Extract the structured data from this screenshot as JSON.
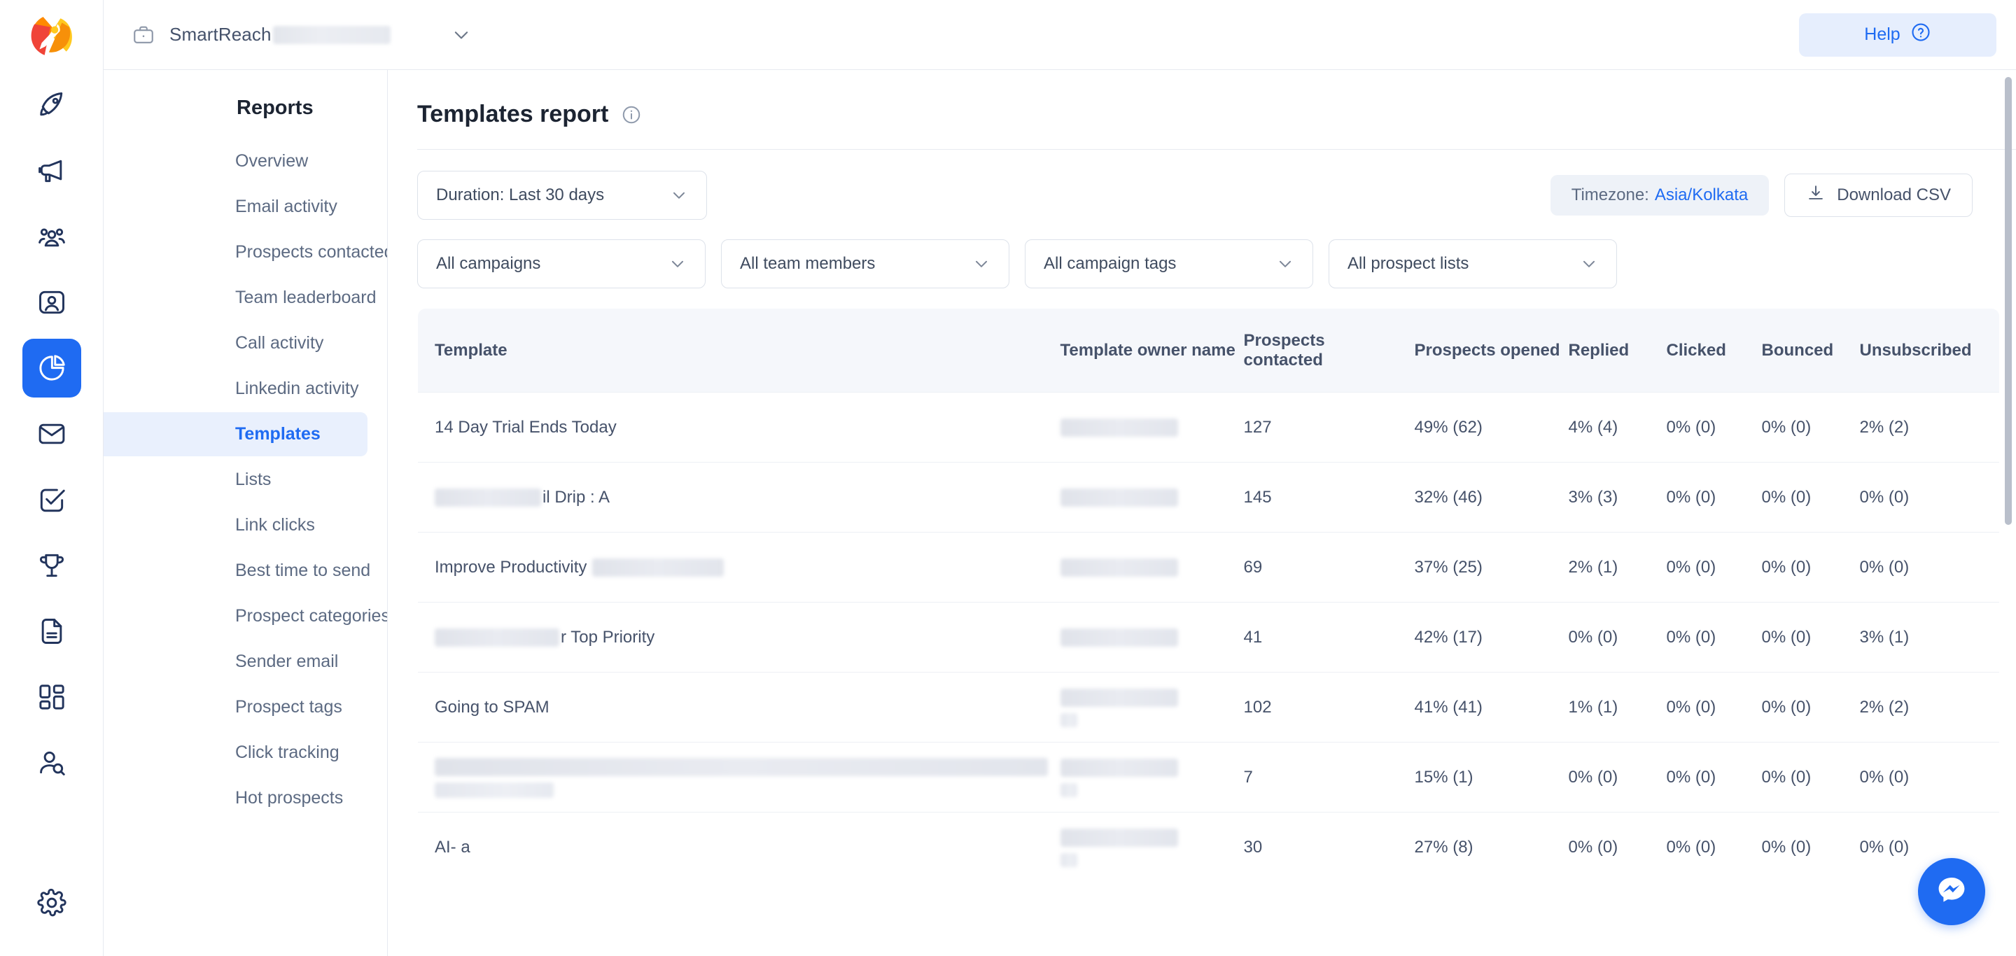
{
  "brand": {
    "name": "SmartReach",
    "logo_icon": "rocket-logo",
    "accent_color": "#1f6bf2"
  },
  "topbar": {
    "workspace_icon": "briefcase-icon",
    "workspace_name": "SmartReach",
    "workspace_name_redacted": true,
    "caret_icon": "chevron-down-icon",
    "help_label": "Help",
    "help_icon": "question-circle-icon"
  },
  "rail": {
    "items": [
      {
        "icon": "rocket-icon",
        "name": "campaigns",
        "active": false
      },
      {
        "icon": "megaphone-icon",
        "name": "outreach",
        "active": false
      },
      {
        "icon": "people-group-icon",
        "name": "prospects",
        "active": false
      },
      {
        "icon": "contact-card-icon",
        "name": "contacts",
        "active": false
      },
      {
        "icon": "pie-chart-icon",
        "name": "reports",
        "active": true
      },
      {
        "icon": "envelope-icon",
        "name": "inbox",
        "active": false
      },
      {
        "icon": "task-check-icon",
        "name": "tasks",
        "active": false
      },
      {
        "icon": "trophy-icon",
        "name": "leaderboard",
        "active": false
      },
      {
        "icon": "document-icon",
        "name": "templates",
        "active": false
      },
      {
        "icon": "grid-apps-icon",
        "name": "apps",
        "active": false
      },
      {
        "icon": "user-search-icon",
        "name": "prospect-finder",
        "active": false
      }
    ],
    "bottom": {
      "icon": "gear-icon",
      "name": "settings"
    }
  },
  "sidebar": {
    "title": "Reports",
    "items": [
      {
        "label": "Overview",
        "active": false
      },
      {
        "label": "Email activity",
        "active": false
      },
      {
        "label": "Prospects contacted",
        "active": false
      },
      {
        "label": "Team leaderboard",
        "active": false
      },
      {
        "label": "Call activity",
        "active": false
      },
      {
        "label": "Linkedin activity",
        "active": false
      },
      {
        "label": "Templates",
        "active": true
      },
      {
        "label": "Lists",
        "active": false
      },
      {
        "label": "Link clicks",
        "active": false
      },
      {
        "label": "Best time to send",
        "active": false
      },
      {
        "label": "Prospect categories",
        "active": false
      },
      {
        "label": "Sender email",
        "active": false
      },
      {
        "label": "Prospect tags",
        "active": false
      },
      {
        "label": "Click tracking",
        "active": false
      },
      {
        "label": "Hot prospects",
        "active": false
      }
    ]
  },
  "main": {
    "title": "Templates report",
    "info_icon": "info-icon",
    "toolbar": {
      "duration_label": "Duration: Last 30 days",
      "timezone_prefix": "Timezone:",
      "timezone_value": "Asia/Kolkata",
      "download_label": "Download CSV",
      "download_icon": "download-icon"
    },
    "filters": [
      {
        "label": "All campaigns",
        "name": "campaigns-filter"
      },
      {
        "label": "All team members",
        "name": "team-members-filter"
      },
      {
        "label": "All campaign tags",
        "name": "campaign-tags-filter"
      },
      {
        "label": "All prospect lists",
        "name": "prospect-lists-filter"
      }
    ],
    "table": {
      "columns": [
        "Template",
        "Template owner name",
        "Prospects contacted",
        "Prospects opened",
        "Replied",
        "Clicked",
        "Bounced",
        "Unsubscribed"
      ],
      "rows": [
        {
          "template": "14 Day Trial Ends Today",
          "template_prefix_redacted": false,
          "template_suffix_redacted": false,
          "owner_redacted": true,
          "owner_two_line": false,
          "contacted": "127",
          "opened": "49% (62)",
          "replied": "4% (4)",
          "clicked": "0% (0)",
          "bounced": "0% (0)",
          "unsubscribed": "2% (2)"
        },
        {
          "template": "il Drip : A",
          "template_prefix_redacted": true,
          "template_suffix_redacted": false,
          "owner_redacted": true,
          "owner_two_line": false,
          "contacted": "145",
          "opened": "32% (46)",
          "replied": "3% (3)",
          "clicked": "0% (0)",
          "bounced": "0% (0)",
          "unsubscribed": "0% (0)"
        },
        {
          "template": "Improve Productivity",
          "template_prefix_redacted": false,
          "template_suffix_redacted": true,
          "owner_redacted": true,
          "owner_two_line": false,
          "contacted": "69",
          "opened": "37% (25)",
          "replied": "2% (1)",
          "clicked": "0% (0)",
          "bounced": "0% (0)",
          "unsubscribed": "0% (0)"
        },
        {
          "template": "r Top Priority",
          "template_prefix_redacted": true,
          "template_suffix_redacted": false,
          "owner_redacted": true,
          "owner_two_line": false,
          "contacted": "41",
          "opened": "42% (17)",
          "replied": "0% (0)",
          "clicked": "0% (0)",
          "bounced": "0% (0)",
          "unsubscribed": "3% (1)"
        },
        {
          "template": "Going to SPAM",
          "template_prefix_redacted": false,
          "template_suffix_redacted": false,
          "owner_redacted": true,
          "owner_two_line": true,
          "contacted": "102",
          "opened": "41% (41)",
          "replied": "1% (1)",
          "clicked": "0% (0)",
          "bounced": "0% (0)",
          "unsubscribed": "2% (2)"
        },
        {
          "template": "",
          "template_prefix_redacted": false,
          "template_suffix_redacted": false,
          "template_fully_redacted": true,
          "owner_redacted": true,
          "owner_two_line": true,
          "contacted": "7",
          "opened": "15% (1)",
          "replied": "0% (0)",
          "clicked": "0% (0)",
          "bounced": "0% (0)",
          "unsubscribed": "0% (0)"
        },
        {
          "template": "AI- a",
          "template_prefix_redacted": false,
          "template_suffix_redacted": false,
          "owner_redacted": true,
          "owner_two_line": true,
          "contacted": "30",
          "opened": "27% (8)",
          "replied": "0% (0)",
          "clicked": "0% (0)",
          "bounced": "0% (0)",
          "unsubscribed": "0% (0)"
        }
      ]
    },
    "chat_icon": "chat-bubble-icon"
  }
}
